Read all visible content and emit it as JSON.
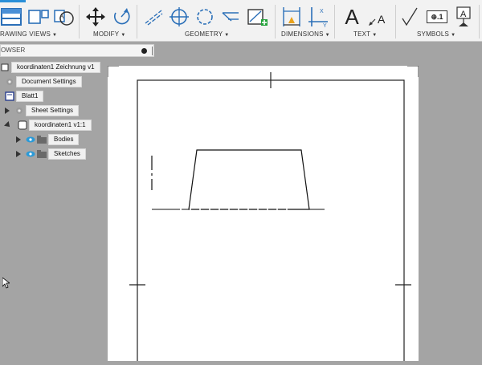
{
  "ribbon": {
    "groups": [
      {
        "label": "RAWING VIEWS"
      },
      {
        "label": "MODIFY"
      },
      {
        "label": "GEOMETRY"
      },
      {
        "label": "DIMENSIONS"
      },
      {
        "label": "TEXT"
      },
      {
        "label": "SYMBOLS"
      }
    ],
    "accent_color": "#2a8fd8",
    "text_symbol": "A",
    "feature_box_label": "⊕.1"
  },
  "browser": {
    "title": "OWSER",
    "items": [
      {
        "label": "koordinaten1 Zeichnung v1",
        "icon": "document-icon"
      },
      {
        "label": "Document Settings",
        "icon": "gear-icon"
      },
      {
        "label": "Blatt1",
        "icon": "sheet-icon"
      },
      {
        "label": "Sheet Settings",
        "icon": "gear-icon"
      },
      {
        "label": "koordinaten1 v1:1",
        "icon": "view-icon"
      },
      {
        "label": "Bodies",
        "icon": "folder-icon"
      },
      {
        "label": "Sketches",
        "icon": "folder-icon"
      }
    ]
  }
}
